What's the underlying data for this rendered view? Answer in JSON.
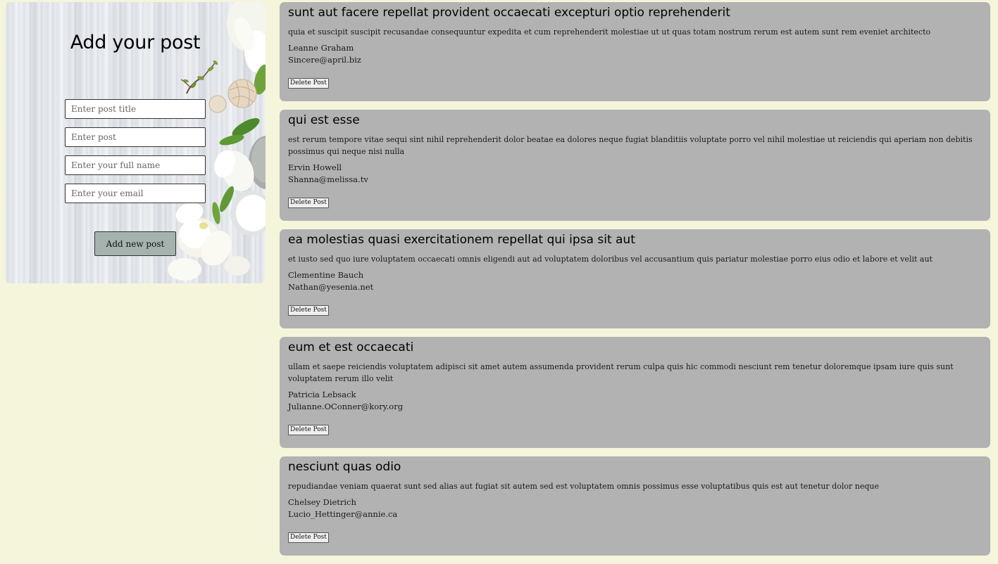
{
  "form": {
    "title": "Add your post",
    "title_placeholder": "Enter post title",
    "post_placeholder": "Enter post",
    "name_placeholder": "Enter your full name",
    "email_placeholder": "Enter your email",
    "submit_label": "Add new post"
  },
  "posts": [
    {
      "title": "sunt aut facere repellat provident occaecati excepturi optio reprehenderit",
      "body": "quia et suscipit suscipit recusandae consequuntur expedita et cum reprehenderit molestiae ut ut quas totam nostrum rerum est autem sunt rem eveniet architecto",
      "author": "Leanne Graham",
      "email": "Sincere@april.biz",
      "delete_label": "Delete Post"
    },
    {
      "title": "qui est esse",
      "body": "est rerum tempore vitae sequi sint nihil reprehenderit dolor beatae ea dolores neque fugiat blanditiis voluptate porro vel nihil molestiae ut reiciendis qui aperiam non debitis possimus qui neque nisi nulla",
      "author": "Ervin Howell",
      "email": "Shanna@melissa.tv",
      "delete_label": "Delete Post"
    },
    {
      "title": "ea molestias quasi exercitationem repellat qui ipsa sit aut",
      "body": "et iusto sed quo iure voluptatem occaecati omnis eligendi aut ad voluptatem doloribus vel accusantium quis pariatur molestiae porro eius odio et labore et velit aut",
      "author": "Clementine Bauch",
      "email": "Nathan@yesenia.net",
      "delete_label": "Delete Post"
    },
    {
      "title": "eum et est occaecati",
      "body": "ullam et saepe reiciendis voluptatem adipisci sit amet autem assumenda provident rerum culpa quis hic commodi nesciunt rem tenetur doloremque ipsam iure quis sunt voluptatem rerum illo velit",
      "author": "Patricia Lebsack",
      "email": "Julianne.OConner@kory.org",
      "delete_label": "Delete Post"
    },
    {
      "title": "nesciunt quas odio",
      "body": "repudiandae veniam quaerat sunt sed alias aut fugiat sit autem sed est voluptatem omnis possimus esse voluptatibus quis est aut tenetur dolor neque",
      "author": "Chelsey Dietrich",
      "email": "Lucio_Hettinger@annie.ca",
      "delete_label": "Delete Post"
    }
  ]
}
